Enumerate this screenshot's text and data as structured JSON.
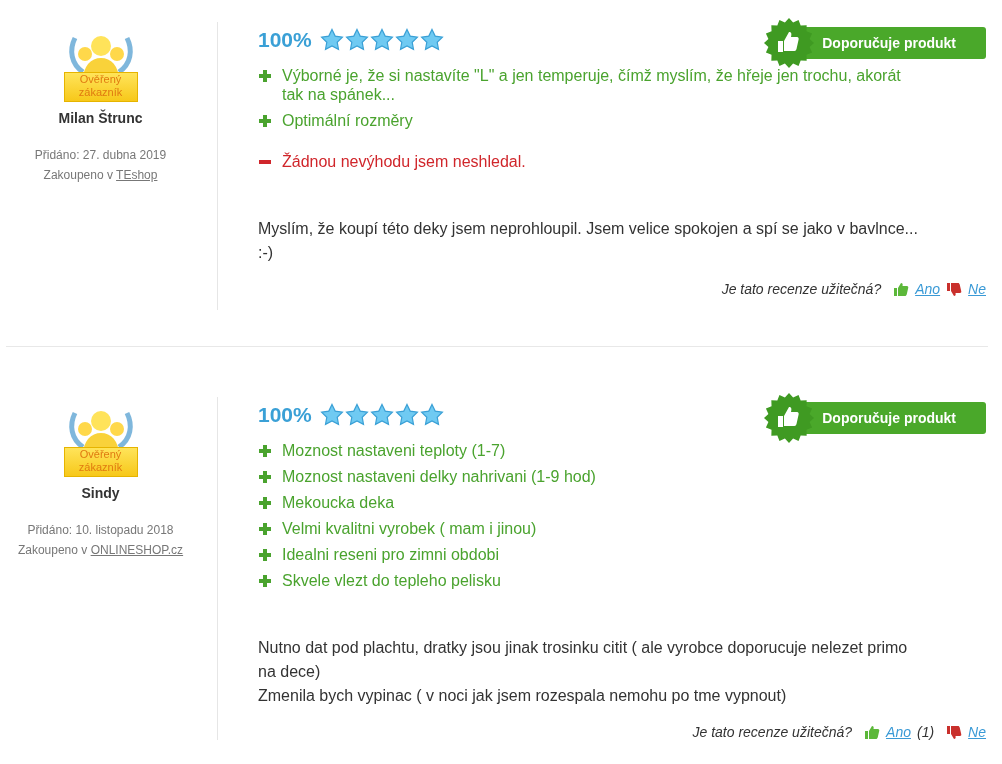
{
  "reviews": [
    {
      "badge": {
        "line1": "Ověřený",
        "line2": "zákazník"
      },
      "author": "Milan Štrunc",
      "added": "Přidáno: 27. dubna 2019",
      "purchased_prefix": "Zakoupeno v",
      "shop": "TEshop",
      "percent": "100%",
      "stars": 5,
      "recommend": "Doporučuje produkt",
      "points": [
        {
          "kind": "pro",
          "text": "Výborné je, že si nastavíte \"L\" a jen temperuje, čímž myslím, že hřeje jen trochu, akorát tak na spánek..."
        },
        {
          "kind": "pro",
          "text": "Optimální rozměry"
        },
        {
          "kind": "con",
          "text": "Žádnou nevýhodu jsem neshledal."
        }
      ],
      "comment": [
        "Myslím, že koupí této deky jsem neprohloupil. Jsem velice spokojen a spí se jako v bavlnce... :-)"
      ],
      "helpful": {
        "question": "Je tato recenze užitečná?",
        "yes": "Ano",
        "no": "Ne"
      }
    },
    {
      "badge": {
        "line1": "Ověřený",
        "line2": "zákazník"
      },
      "author": "Sindy",
      "added": "Přidáno: 10. listopadu 2018",
      "purchased_prefix": "Zakoupeno v",
      "shop": "ONLINESHOP.cz",
      "percent": "100%",
      "stars": 5,
      "recommend": "Doporučuje produkt",
      "points": [
        {
          "kind": "pro",
          "text": "Moznost nastaveni teploty (1-7)"
        },
        {
          "kind": "pro",
          "text": "Moznost nastaveni delky nahrivani (1-9 hod)"
        },
        {
          "kind": "pro",
          "text": "Mekoucka deka"
        },
        {
          "kind": "pro",
          "text": "Velmi kvalitni vyrobek ( mam i jinou)"
        },
        {
          "kind": "pro",
          "text": "Idealni reseni pro zimni obdobi"
        },
        {
          "kind": "pro",
          "text": "Skvele vlezt do tepleho pelisku"
        }
      ],
      "comment": [
        "Nutno dat pod plachtu, dratky jsou jinak trosinku citit ( ale vyrobce doporucuje nelezet primo na dece)",
        "Zmenila bych vypinac ( v noci jak jsem rozespala nemohu po tme vypnout)"
      ],
      "helpful": {
        "question": "Je tato recenze užitečná?",
        "yes": "Ano ",
        "yes_count": "(1)",
        "no": "Ne"
      }
    }
  ]
}
